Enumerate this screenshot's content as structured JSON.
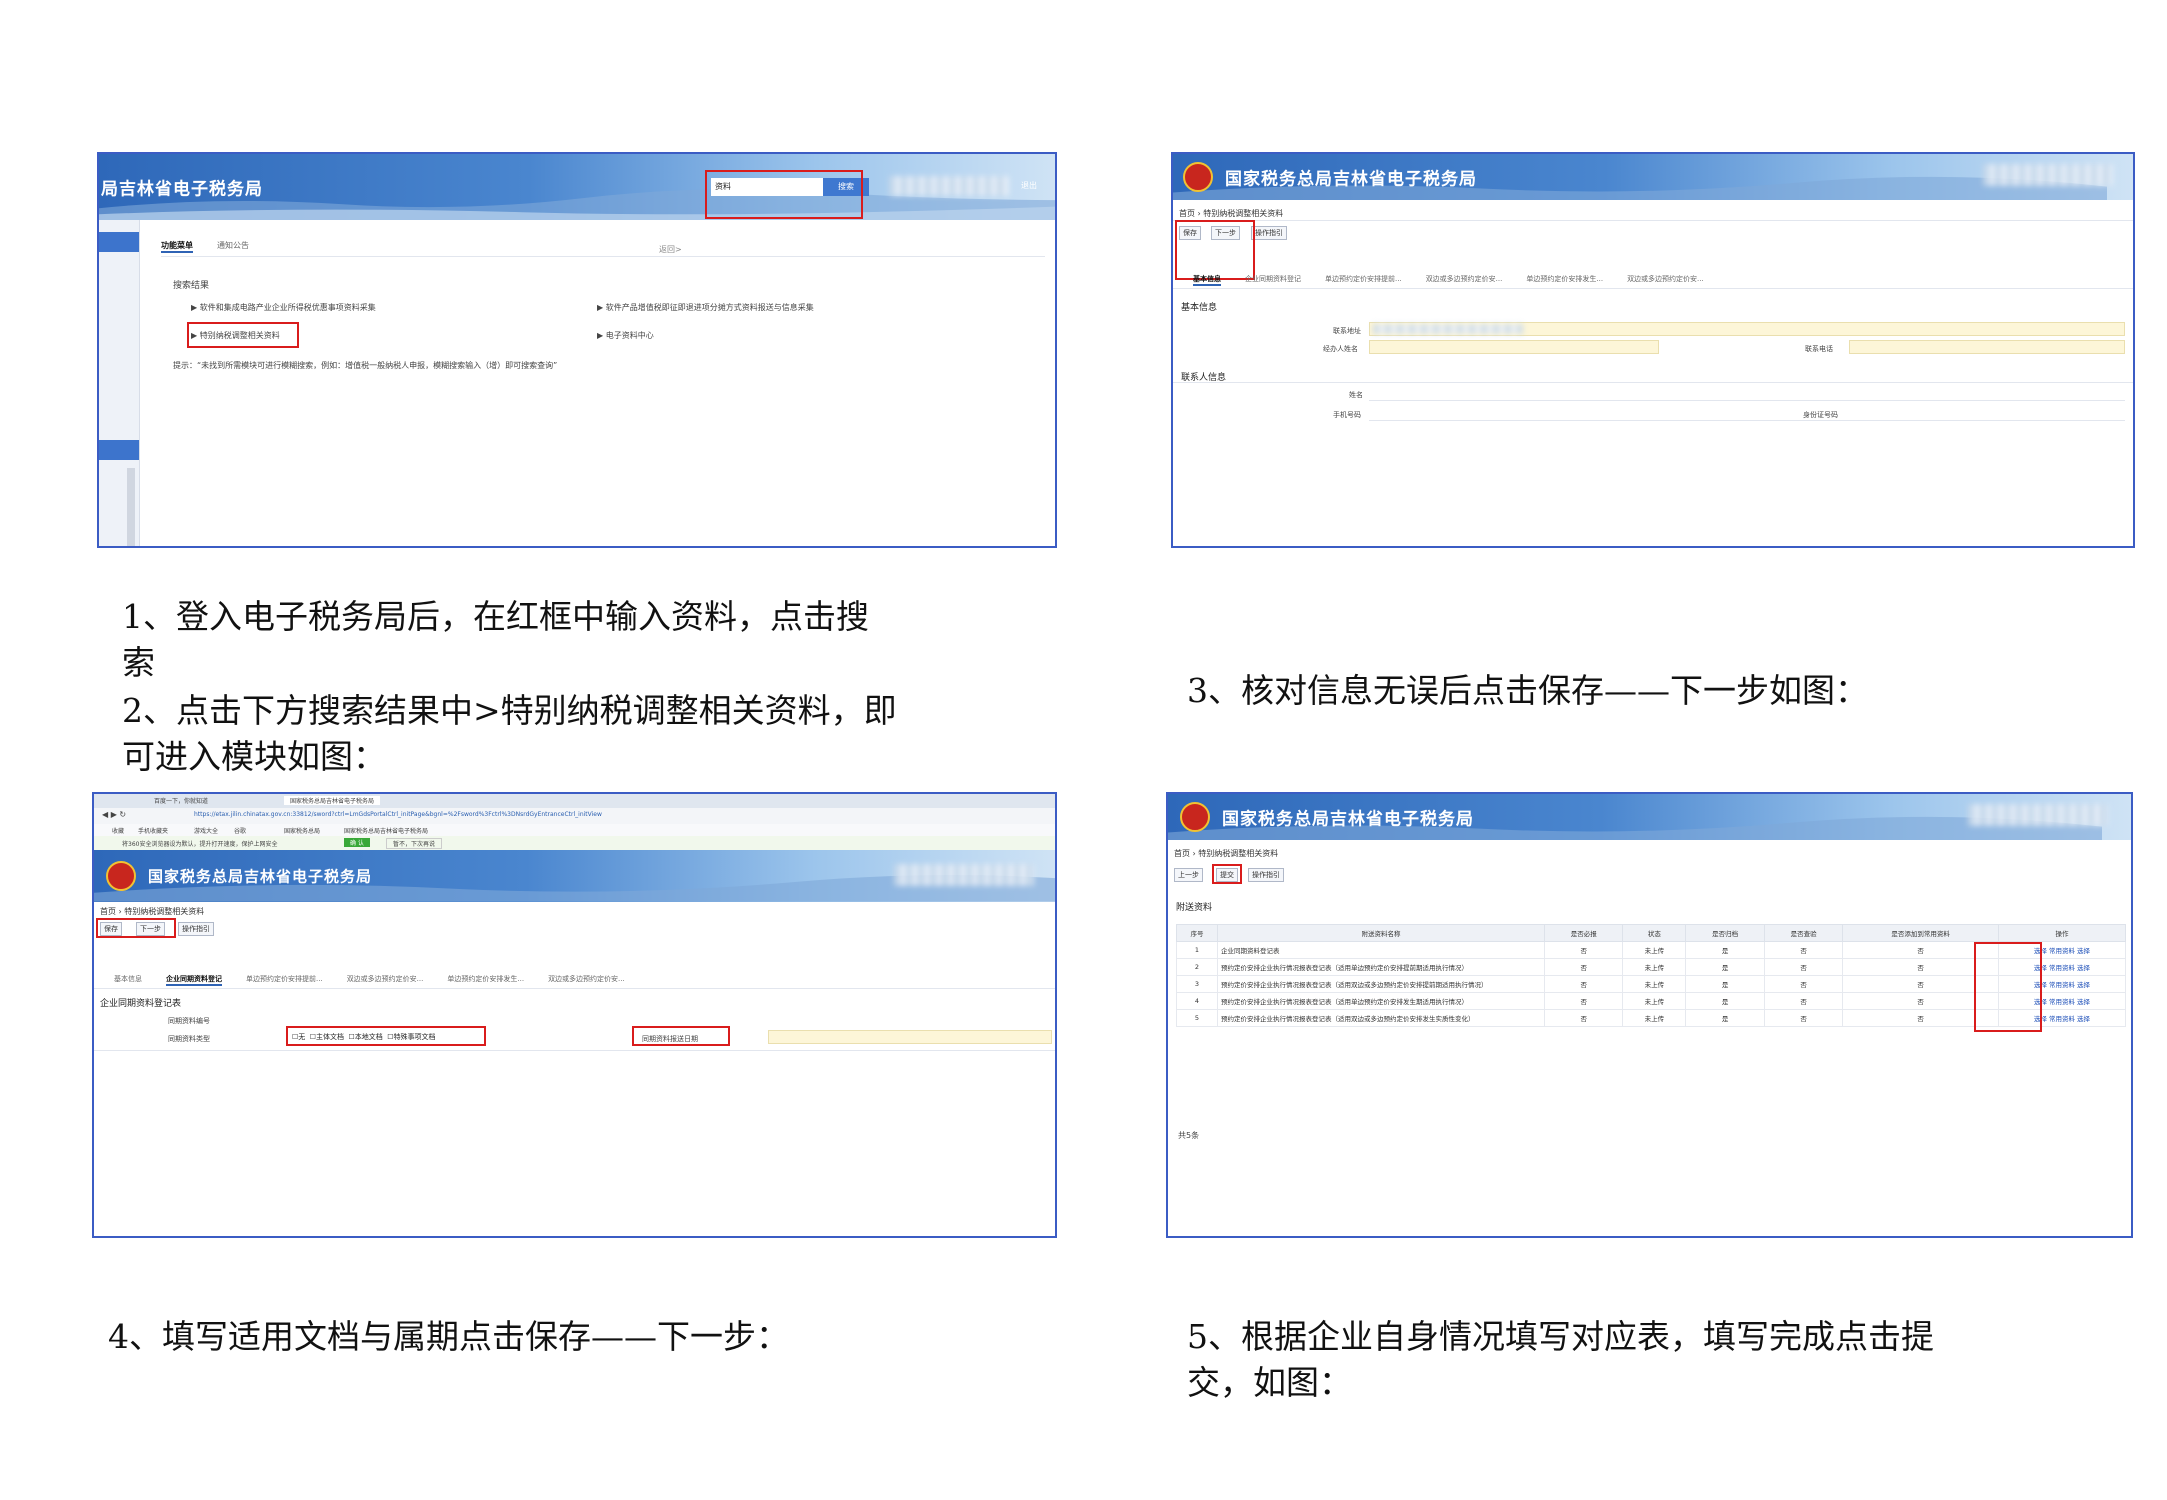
{
  "captions": {
    "step1": "1、登入电子税务局后，在红框中输入资料，点击搜",
    "step1_cont": "索",
    "step2": "2、点击下方搜索结果中>特别纳税调整相关资料，即",
    "step2_cont": "可进入模块如图：",
    "step3": "3、核对信息无误后点击保存——下一步如图：",
    "step4": "4、填写适用文档与属期点击保存——下一步：",
    "step5": "5、根据企业自身情况填写对应表，填写完成点击提",
    "step5_cont": "交，如图："
  },
  "shot1": {
    "title": "局吉林省电子税务局",
    "search_value": "资料",
    "search_button": "搜索",
    "top_right": "退出",
    "tabs": [
      "功能菜单",
      "通知公告"
    ],
    "tab_extra": "返回>",
    "results_heading": "搜索结果",
    "results": [
      "软件和集成电路产业企业所得税优惠事项资料采集",
      "软件产品增值税即征即退进项分摊方式资料报送与信息采集",
      "特别纳税调整相关资料",
      "电子资料中心"
    ],
    "hint": "提示：“未找到所需模块可进行模糊搜索，例如：增值税一般纳税人申报，模糊搜索输入（增）即可搜索查询”"
  },
  "shot2": {
    "title": "国家税务总局吉林省电子税务局",
    "breadcrumb": "首页 › 特别纳税调整相关资料",
    "toolbar": [
      "保存",
      "下一步",
      "操作指引"
    ],
    "tabs": [
      "基本信息",
      "企业同期资料登记",
      "单边预约定价安排提前...",
      "双边或多边预约定价安...",
      "单边预约定价安排发生...",
      "双边或多边预约定价安..."
    ],
    "section_basic": "基本信息",
    "section_contact": "联系人信息",
    "fields": [
      "联系地址",
      "经办人姓名",
      "联系电话",
      "姓名",
      "手机号码",
      "身份证号码"
    ]
  },
  "shot3": {
    "browser_tabs": [
      "百度一下，你就知道",
      "国家税务总局吉林省电子税务局"
    ],
    "address": "https://etax.jilin.chinatax.gov.cn:33812/sword?ctrl=LmGdsPortalCtrl_initPage&bgnl=%2Fsword%3Fctrl%3DNsrdGyEntranceCtrl_initView",
    "bookmarks": [
      "收藏",
      "手机收藏夹",
      "游戏大全",
      "谷歌",
      "国家税务总局",
      "国家税务总局吉林省电子税务局"
    ],
    "notice": "将360安全浏览器设为默认，提升打开速度，保护上网安全",
    "notice_btn": "确 认",
    "notice_btn2": "暂不，下次再说",
    "title": "国家税务总局吉林省电子税务局",
    "breadcrumb": "首页 › 特别纳税调整相关资料",
    "toolbar": [
      "保存",
      "下一步",
      "操作指引"
    ],
    "tabs": [
      "基本信息",
      "企业同期资料登记",
      "单边预约定价安排提前...",
      "双边或多边预约定价安...",
      "单边预约定价安排发生...",
      "双边或多边预约定价安..."
    ],
    "section": "企业同期资料登记表",
    "row1_label": "同期资料编号",
    "row2_label": "同期资料类型",
    "checkboxes": [
      "无",
      "主体文档",
      "本地文档",
      "特殊事项文档"
    ],
    "period_label": "同期资料报送日期"
  },
  "shot4": {
    "title": "国家税务总局吉林省电子税务局",
    "breadcrumb": "首页 › 特别纳税调整相关资料",
    "toolbar": [
      "上一步",
      "提交",
      "操作指引"
    ],
    "section": "附送资料",
    "headers": [
      "序号",
      "附送资料名称",
      "是否必报",
      "状态",
      "是否归档",
      "是否查验",
      "是否添加到常用资料",
      "操作"
    ],
    "rows": [
      [
        "1",
        "企业同期资料登记表",
        "否",
        "未上传",
        "是",
        "否",
        "否",
        "选择 常用资料 选择"
      ],
      [
        "2",
        "预约定价安排企业执行情况报表登记表（适用单边预约定价安排提前期适用执行情况）",
        "否",
        "未上传",
        "是",
        "否",
        "否",
        "选择 常用资料 选择"
      ],
      [
        "3",
        "预约定价安排企业执行情况报表登记表（适用双边或多边预约定价安排提前期适用执行情况）",
        "否",
        "未上传",
        "是",
        "否",
        "否",
        "选择 常用资料 选择"
      ],
      [
        "4",
        "预约定价安排企业执行情况报表登记表（适用单边预约定价安排发生期适用执行情况）",
        "否",
        "未上传",
        "是",
        "否",
        "否",
        "选择 常用资料 选择"
      ],
      [
        "5",
        "预约定价安排企业执行情况报表登记表（适用双边或多边预约定价安排发生实质性变化）",
        "否",
        "未上传",
        "是",
        "否",
        "否",
        "选择 常用资料 选择"
      ]
    ],
    "footer": "共5条"
  }
}
